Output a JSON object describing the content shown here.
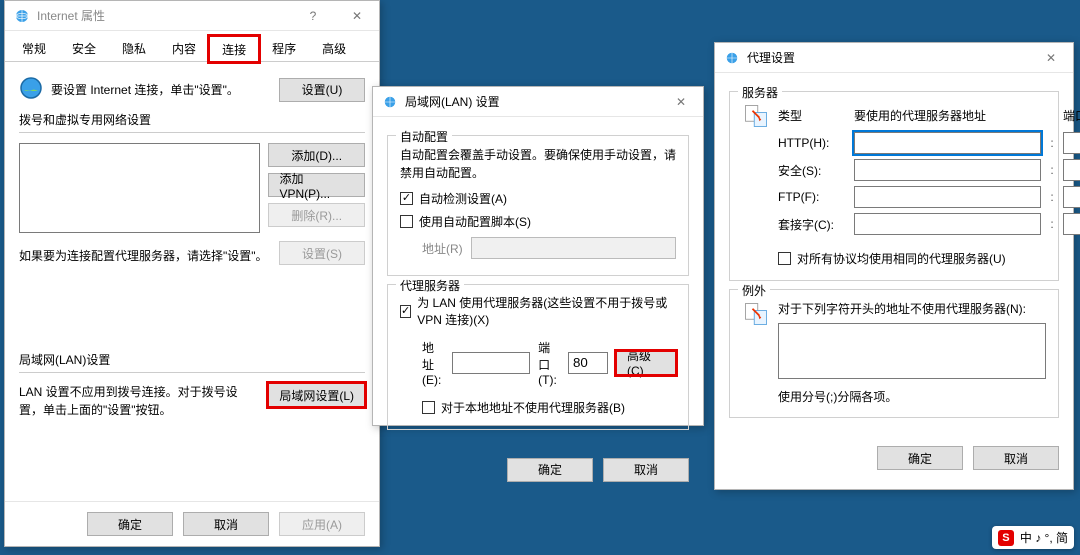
{
  "desktop": {
    "ime": {
      "s": "S",
      "text": "中 ♪ °, 简"
    }
  },
  "win1": {
    "title": "Internet 属性",
    "tabs": [
      "常规",
      "安全",
      "隐私",
      "内容",
      "连接",
      "程序",
      "高级"
    ],
    "active_tab_index": 4,
    "setup_hint": "要设置 Internet 连接，单击\"设置\"。",
    "setup_btn": "设置(U)",
    "dialup_label": "拨号和虚拟专用网络设置",
    "btn_add": "添加(D)...",
    "btn_add_vpn": "添加 VPN(P)...",
    "btn_remove": "删除(R)...",
    "btn_settings": "设置(S)",
    "dial_note": "如果要为连接配置代理服务器，请选择\"设置\"。",
    "lan_label": "局域网(LAN)设置",
    "lan_note": "LAN 设置不应用到拨号连接。对于拨号设置，单击上面的\"设置\"按钮。",
    "btn_lan": "局域网设置(L)",
    "btn_ok": "确定",
    "btn_cancel": "取消",
    "btn_apply": "应用(A)"
  },
  "win2": {
    "title": "局域网(LAN) 设置",
    "group_auto": "自动配置",
    "auto_note": "自动配置会覆盖手动设置。要确保使用手动设置，请禁用自动配置。",
    "cb_auto_detect": "自动检测设置(A)",
    "cb_auto_script": "使用自动配置脚本(S)",
    "addr_label": "地址(R)",
    "group_proxy": "代理服务器",
    "cb_use_proxy": "为 LAN 使用代理服务器(这些设置不用于拨号或 VPN 连接)(X)",
    "addr2_label": "地址(E):",
    "port_label": "端口(T):",
    "port_value": "80",
    "btn_advanced": "高级(C)",
    "cb_bypass_local": "对于本地地址不使用代理服务器(B)",
    "btn_ok": "确定",
    "btn_cancel": "取消"
  },
  "win3": {
    "title": "代理设置",
    "group_servers": "服务器",
    "col_type": "类型",
    "col_addr": "要使用的代理服务器地址",
    "col_port": "端口",
    "row_http": "HTTP(H):",
    "row_secure": "安全(S):",
    "row_ftp": "FTP(F):",
    "row_socks": "套接字(C):",
    "cb_same_all": "对所有协议均使用相同的代理服务器(U)",
    "group_exceptions": "例外",
    "except_note": "对于下列字符开头的地址不使用代理服务器(N):",
    "except_hint": "使用分号(;)分隔各项。",
    "btn_ok": "确定",
    "btn_cancel": "取消"
  }
}
